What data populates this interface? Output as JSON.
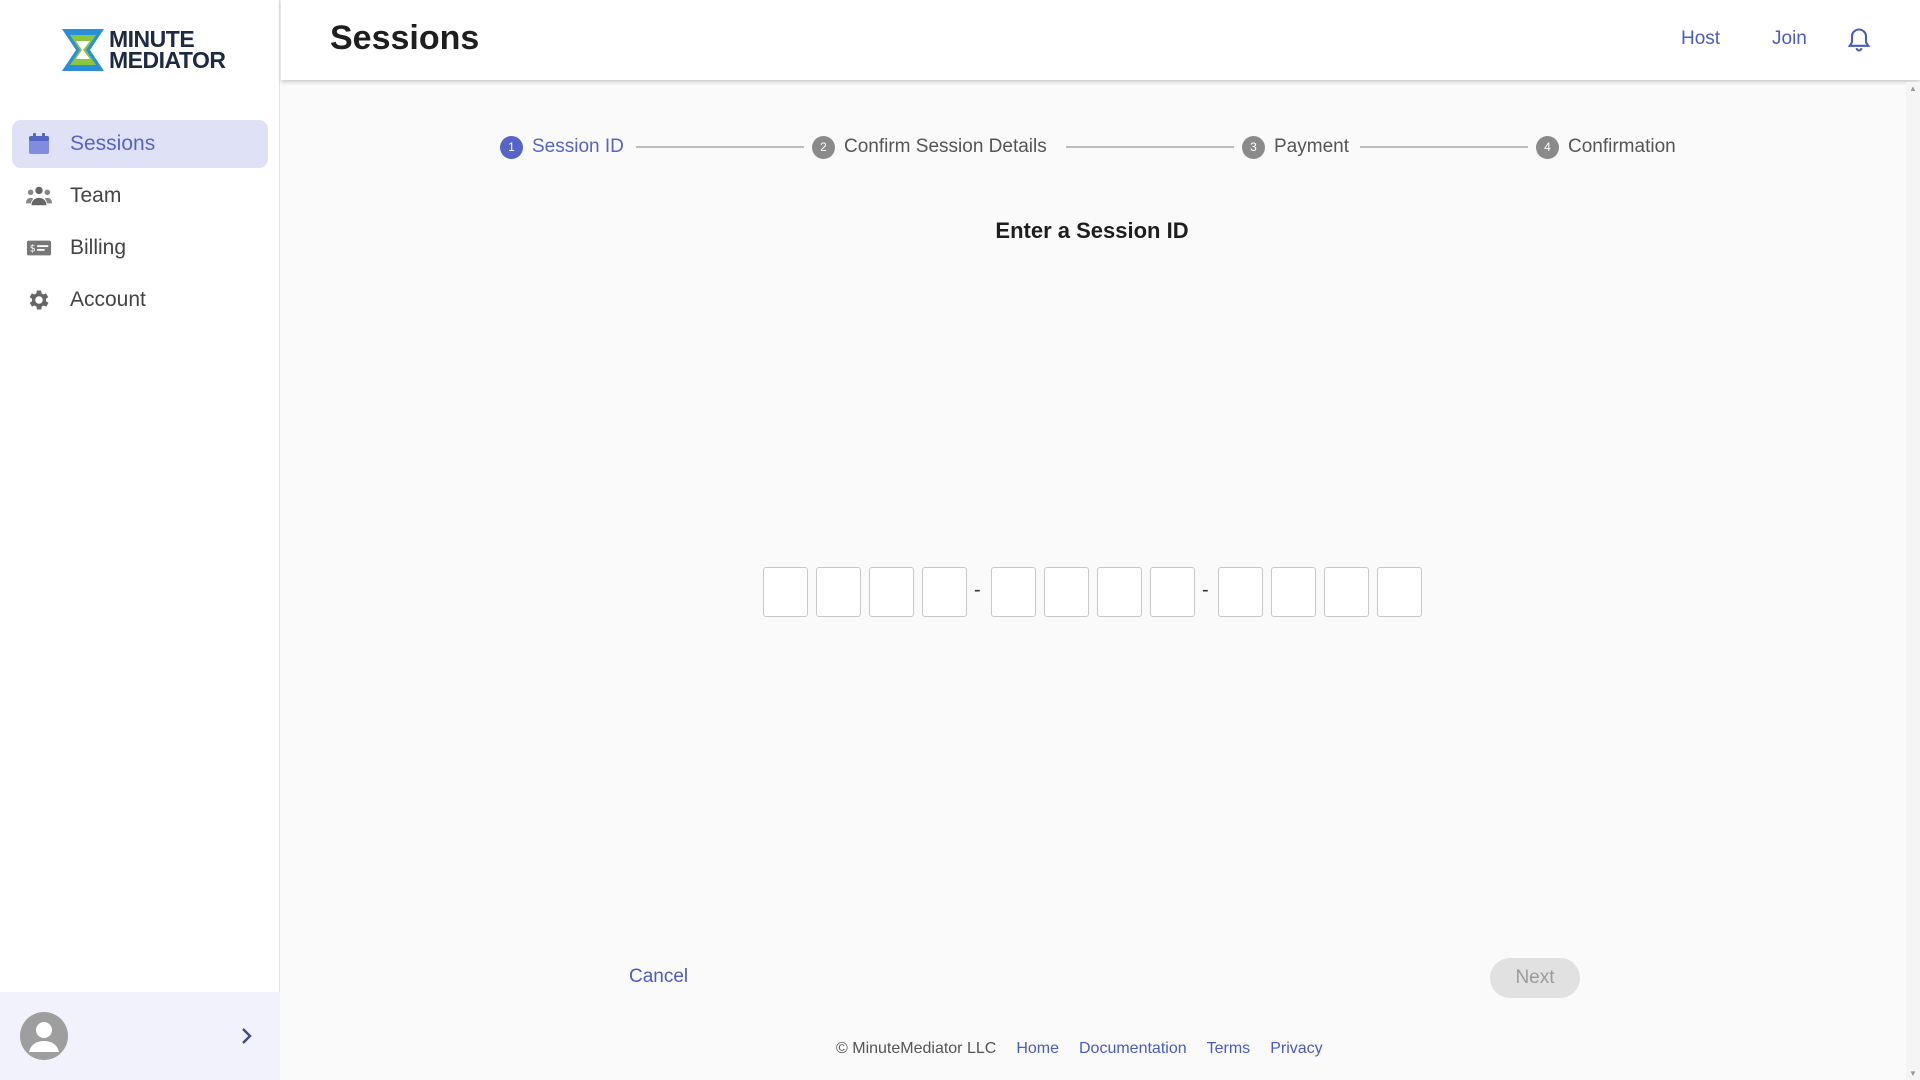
{
  "brand": {
    "logo_line1": "MINUTE",
    "logo_line2": "MEDIATOR",
    "colors": {
      "blue": "#2a8fd6",
      "green": "#8cc63f",
      "navy": "#1d2a44"
    }
  },
  "sidebar": {
    "items": [
      {
        "label": "Sessions",
        "icon": "calendar-icon",
        "active": true
      },
      {
        "label": "Team",
        "icon": "team-icon",
        "active": false
      },
      {
        "label": "Billing",
        "icon": "billing-icon",
        "active": false
      },
      {
        "label": "Account",
        "icon": "gear-icon",
        "active": false
      }
    ]
  },
  "header": {
    "title": "Sessions",
    "links": [
      "Host",
      "Join"
    ],
    "bell_icon": "bell-icon"
  },
  "stepper": {
    "steps": [
      {
        "num": "1",
        "label": "Session ID",
        "active": true
      },
      {
        "num": "2",
        "label": "Confirm Session Details",
        "active": false
      },
      {
        "num": "3",
        "label": "Payment",
        "active": false
      },
      {
        "num": "4",
        "label": "Confirmation",
        "active": false
      }
    ]
  },
  "main": {
    "heading": "Enter a Session ID",
    "code_groups": [
      4,
      4,
      4
    ],
    "separator": "-",
    "cancel_label": "Cancel",
    "next_label": "Next"
  },
  "footer": {
    "copyright": "© MinuteMediator LLC",
    "links": [
      "Home",
      "Documentation",
      "Terms",
      "Privacy"
    ]
  },
  "theme": {
    "accent": "#5564c7",
    "link": "#4a5bc2"
  }
}
